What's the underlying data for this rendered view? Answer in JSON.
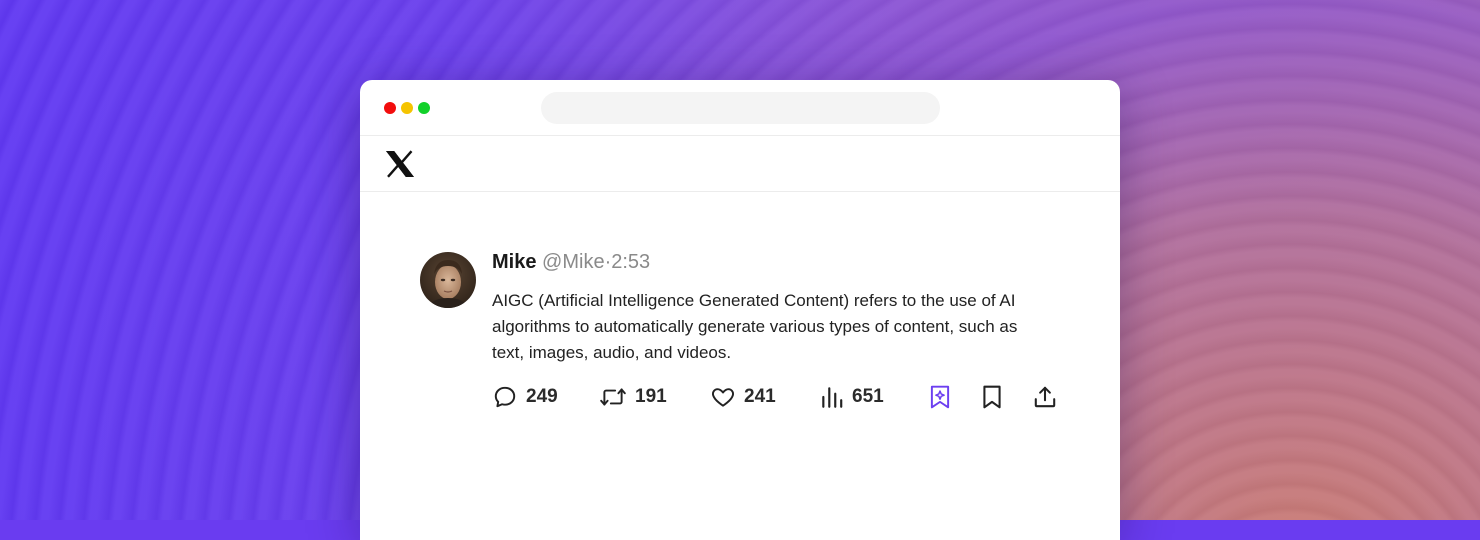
{
  "brand": {
    "accent": "#6c3ff0",
    "logo_icon": "x-logo-icon"
  },
  "tweet": {
    "name": "Mike",
    "handle": "@Mike",
    "separator": "·",
    "time": "2:53",
    "text": "AIGC (Artificial Intelligence Generated Content) refers to the use of AI algorithms to automatically generate various types of content, such as text, images, audio, and videos.",
    "actions": {
      "reply": {
        "icon": "reply-icon",
        "count": "249"
      },
      "retweet": {
        "icon": "retweet-icon",
        "count": "191"
      },
      "like": {
        "icon": "heart-icon",
        "count": "241"
      },
      "views": {
        "icon": "views-icon",
        "count": "651"
      },
      "ai_bookmark": {
        "icon": "sparkle-bookmark-icon"
      },
      "bookmark": {
        "icon": "bookmark-icon"
      },
      "share": {
        "icon": "share-icon"
      }
    }
  }
}
